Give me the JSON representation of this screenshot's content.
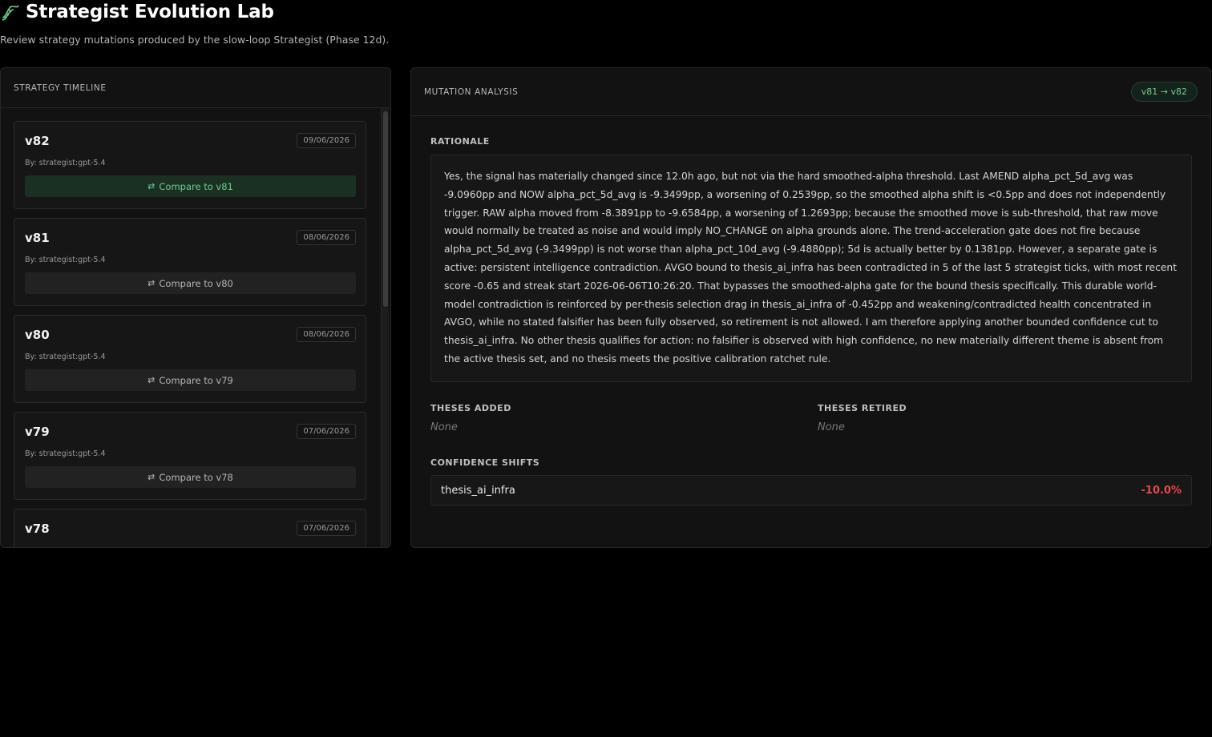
{
  "header": {
    "title": "Strategist Evolution Lab",
    "subtitle": "Review strategy mutations produced by the slow-loop Strategist (Phase 12d).",
    "logo_icon": "dna-icon"
  },
  "timeline": {
    "title": "STRATEGY TIMELINE",
    "versions": [
      {
        "name": "v82",
        "date": "09/06/2026",
        "author": "By: strategist:gpt-5.4",
        "compare_label": "Compare to v81",
        "selected": true
      },
      {
        "name": "v81",
        "date": "08/06/2026",
        "author": "By: strategist:gpt-5.4",
        "compare_label": "Compare to v80",
        "selected": false
      },
      {
        "name": "v80",
        "date": "08/06/2026",
        "author": "By: strategist:gpt-5.4",
        "compare_label": "Compare to v79",
        "selected": false
      },
      {
        "name": "v79",
        "date": "07/06/2026",
        "author": "By: strategist:gpt-5.4",
        "compare_label": "Compare to v78",
        "selected": false
      },
      {
        "name": "v78",
        "date": "07/06/2026",
        "author": "",
        "compare_label": "",
        "selected": false
      }
    ]
  },
  "analysis": {
    "title": "MUTATION ANALYSIS",
    "version_pill": "v81 → v82",
    "rationale_label": "RATIONALE",
    "rationale": "Yes, the signal has materially changed since 12.0h ago, but not via the hard smoothed-alpha threshold. Last AMEND alpha_pct_5d_avg was -9.0960pp and NOW alpha_pct_5d_avg is -9.3499pp, a worsening of 0.2539pp, so the smoothed alpha shift is <0.5pp and does not independently trigger. RAW alpha moved from -8.3891pp to -9.6584pp, a worsening of 1.2693pp; because the smoothed move is sub-threshold, that raw move would normally be treated as noise and would imply NO_CHANGE on alpha grounds alone. The trend-acceleration gate does not fire because alpha_pct_5d_avg (-9.3499pp) is not worse than alpha_pct_10d_avg (-9.4880pp); 5d is actually better by 0.1381pp. However, a separate gate is active: persistent intelligence contradiction. AVGO bound to thesis_ai_infra has been contradicted in 5 of the last 5 strategist ticks, with most recent score -0.65 and streak start 2026-06-06T10:26:20. That bypasses the smoothed-alpha gate for the bound thesis specifically. This durable world-model contradiction is reinforced by per-thesis selection drag in thesis_ai_infra of -0.452pp and weakening/contradicted health concentrated in AVGO, while no stated falsifier has been fully observed, so retirement is not allowed. I am therefore applying another bounded confidence cut to thesis_ai_infra. No other thesis qualifies for action: no falsifier is observed with high confidence, no new materially different theme is absent from the active thesis set, and no thesis meets the positive calibration ratchet rule.",
    "theses_added_label": "THESES ADDED",
    "theses_added": "None",
    "theses_retired_label": "THESES RETIRED",
    "theses_retired": "None",
    "confidence_shifts_label": "CONFIDENCE SHIFTS",
    "confidence_shifts": [
      {
        "thesis": "thesis_ai_infra",
        "change": "-10.0%"
      }
    ]
  },
  "colors": {
    "accent_green": "#6fcf8e",
    "negative_red": "#e5484d"
  }
}
